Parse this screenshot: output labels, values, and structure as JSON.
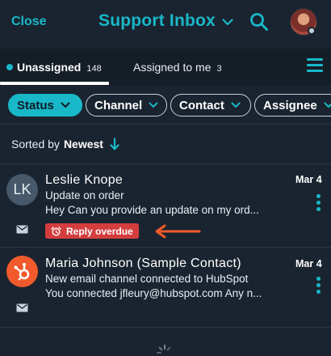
{
  "header": {
    "close_label": "Close",
    "title": "Support Inbox",
    "title_icon": "chevron-down-icon",
    "search_icon": "search-icon",
    "accent": "#19b8c9"
  },
  "tabs": [
    {
      "label": "Unassigned",
      "count": "148",
      "active": true
    },
    {
      "label": "Assigned to me",
      "count": "3",
      "active": false
    }
  ],
  "filters": [
    {
      "label": "Status",
      "active": true
    },
    {
      "label": "Channel",
      "active": false
    },
    {
      "label": "Contact",
      "active": false
    },
    {
      "label": "Assignee",
      "active": false
    }
  ],
  "sort": {
    "prefix": "Sorted by",
    "value": "Newest",
    "icon": "arrow-down-icon"
  },
  "conversations": [
    {
      "initials": "LK",
      "name": "Leslie Knope",
      "subject": "Update on order",
      "preview": "Hey  Can you provide an update on my ord...",
      "date": "Mar 4",
      "channel_icon": "envelope-icon",
      "badge": "Reply overdue",
      "badge_color": "#d43d3d"
    },
    {
      "initials": "",
      "avatar_icon": "hubspot-sprocket-icon",
      "name": "Maria Johnson (Sample Contact)",
      "subject": "New email channel connected to HubSpot",
      "preview": "You connected jfleury@hubspot.com Any n...",
      "date": "Mar 4",
      "channel_icon": "envelope-icon"
    }
  ],
  "annotation": {
    "color": "#f15a2b"
  }
}
